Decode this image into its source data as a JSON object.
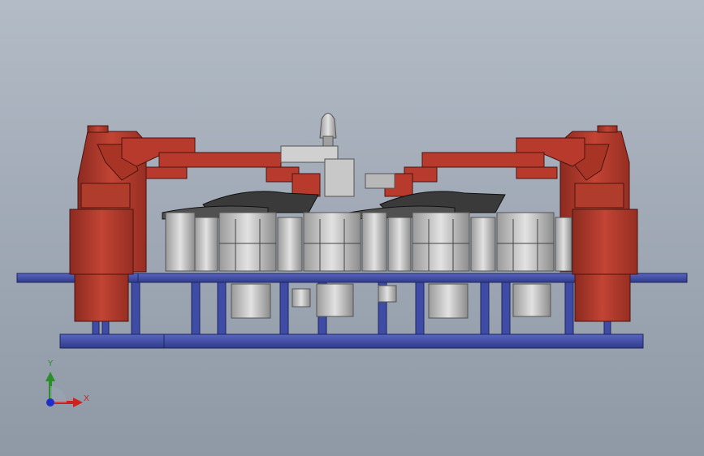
{
  "viewport": {
    "background_top": "#b3bcc6",
    "background_bottom": "#8f99a6"
  },
  "model": {
    "colors": {
      "clamp_red": "#b83a2c",
      "clamp_red_dark": "#8c2a20",
      "base_blue": "#4a57b0",
      "base_blue_dark": "#2e3a86",
      "fixture_gray": "#c8c8c8",
      "fixture_gray_dark": "#7a7a7a",
      "part_black": "#2a2a2a"
    }
  },
  "triad": {
    "x_label": "X",
    "y_label": "Y",
    "x_color": "#d02020",
    "y_color": "#2a8f2a",
    "z_color": "#1e2ec8"
  }
}
